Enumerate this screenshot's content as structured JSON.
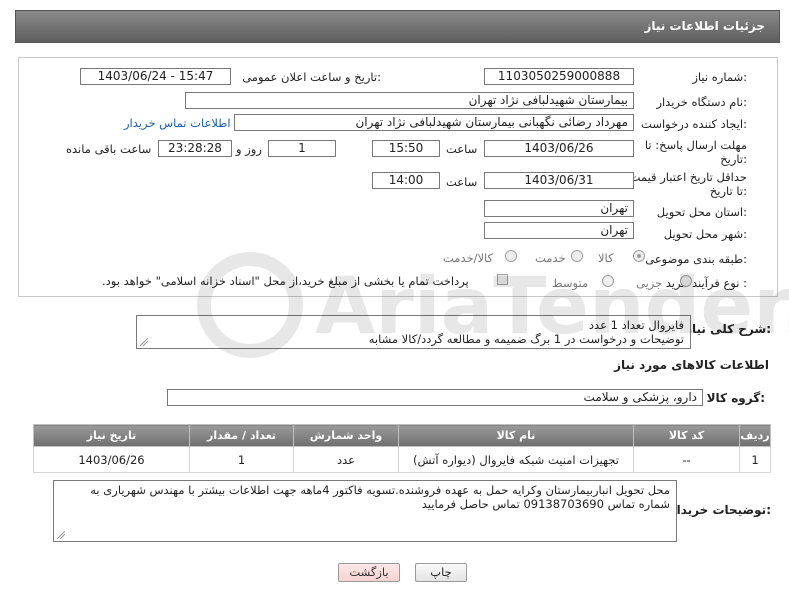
{
  "header": {
    "title": "جزئیات اطلاعات نیاز"
  },
  "form": {
    "need_number_label": "شماره نیاز:",
    "need_number": "1103050259000888",
    "announce_label": "تاریخ و ساعت اعلان عمومی:",
    "announce_value": "1403/06/24 - 15:47",
    "buyer_org_label": "نام دستگاه خریدار:",
    "buyer_org": "بیمارستان شهیدلبافی نژاد تهران",
    "requester_label": "ایجاد کننده درخواست:",
    "requester": "مهرداد رضائی نگهبانی بیمارستان شهیدلبافی نژاد تهران",
    "contact_link": "اطلاعات تماس خریدار",
    "reply_deadline_label": "مهلت ارسال پاسخ: تا تاریخ:",
    "reply_date": "1403/06/26",
    "time_label": "ساعت",
    "reply_time": "15:50",
    "days_value": "1",
    "days_and_label": "روز و",
    "remaining_time": "23:28:28",
    "remaining_label": "ساعت باقی مانده",
    "price_validity_label": "حداقل تاریخ اعتبار قیمت: تا تاریخ:",
    "price_date": "1403/06/31",
    "time_label2": "ساعت",
    "price_time": "14:00",
    "province_label": "استان محل تحویل:",
    "province": "تهران",
    "city_label": "شهر محل تحویل:",
    "city": "تهران",
    "category_label": "طبقه بندی موضوعی:",
    "category_options": [
      "کالا",
      "خدمت",
      "کالا/خدمت"
    ],
    "process_label": "نوع فرآیند خرید :",
    "process_options": [
      "جزیی",
      "متوسط"
    ],
    "treasury_note": "پرداخت تمام یا بخشی از مبلغ خرید،از محل \"اسناد خزانه اسلامی\" خواهد بود."
  },
  "description": {
    "label": "شرح کلی نیاز:",
    "line1": "فایروال تعداد 1 عدد",
    "line2": "توضیحات و درخواست در 1 برگ ضمیمه و مطالعه گردد/کالا مشابه"
  },
  "goods_section": {
    "title": "اطلاعات کالاهای مورد نیاز",
    "group_label": "گروه کالا:",
    "group_value": "دارو، پزشکی و سلامت"
  },
  "table": {
    "headers": [
      "ردیف",
      "کد کالا",
      "نام کالا",
      "واحد شمارش",
      "تعداد / مقدار",
      "تاریخ نیاز"
    ],
    "rows": [
      [
        "1",
        "--",
        "تجهیزات امنیت شبکه فایروال (دیواره آتش)",
        "عدد",
        "1",
        "1403/06/26"
      ]
    ]
  },
  "buyer_notes": {
    "label": "توضیحات خریدار:",
    "text": "محل تحویل انباربیمارستان وکرایه حمل به عهده فروشنده.تسویه فاکتور 4ماهه جهت اطلاعات بیشتر با مهندس شهریاری به شماره تماس 09138703690 تماس حاصل فرمایید"
  },
  "buttons": {
    "print": "چاپ",
    "back": "بازگشت"
  },
  "watermark_text": "AriaTender.net"
}
